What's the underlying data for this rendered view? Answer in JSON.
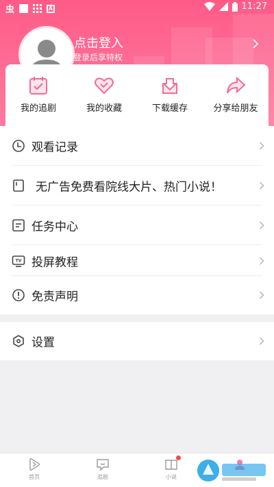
{
  "status_bar": {
    "left_glyph": "虫",
    "time": "11:27"
  },
  "header": {
    "login_title": "点击登入",
    "login_subtitle": "登录后享特权"
  },
  "quick_actions": [
    {
      "label": "我的追剧",
      "icon": "calendar-check-icon"
    },
    {
      "label": "我的收藏",
      "icon": "heart-icon"
    },
    {
      "label": "下载缓存",
      "icon": "download-icon"
    },
    {
      "label": "分享给朋友",
      "icon": "share-arrow-icon"
    }
  ],
  "menu": [
    {
      "label": "观看记录",
      "icon": "clock-icon"
    },
    {
      "label": "无广告免费看院线大片、热门小说！",
      "icon": "phone-icon"
    },
    {
      "label": "任务中心",
      "icon": "task-list-icon"
    },
    {
      "label": "投屏教程",
      "icon": "tv-icon"
    },
    {
      "label": "免责声明",
      "icon": "exclamation-circle-icon"
    }
  ],
  "settings": {
    "label": "设置",
    "icon": "hexagon-gear-icon"
  },
  "tabs": [
    {
      "label": "首页",
      "icon": "play-icon"
    },
    {
      "label": "追剧",
      "icon": "chat-icon"
    },
    {
      "label": "小说",
      "icon": "book-icon"
    }
  ],
  "colors": {
    "accent": "#fe5b88",
    "badge": "#f04a4a"
  }
}
